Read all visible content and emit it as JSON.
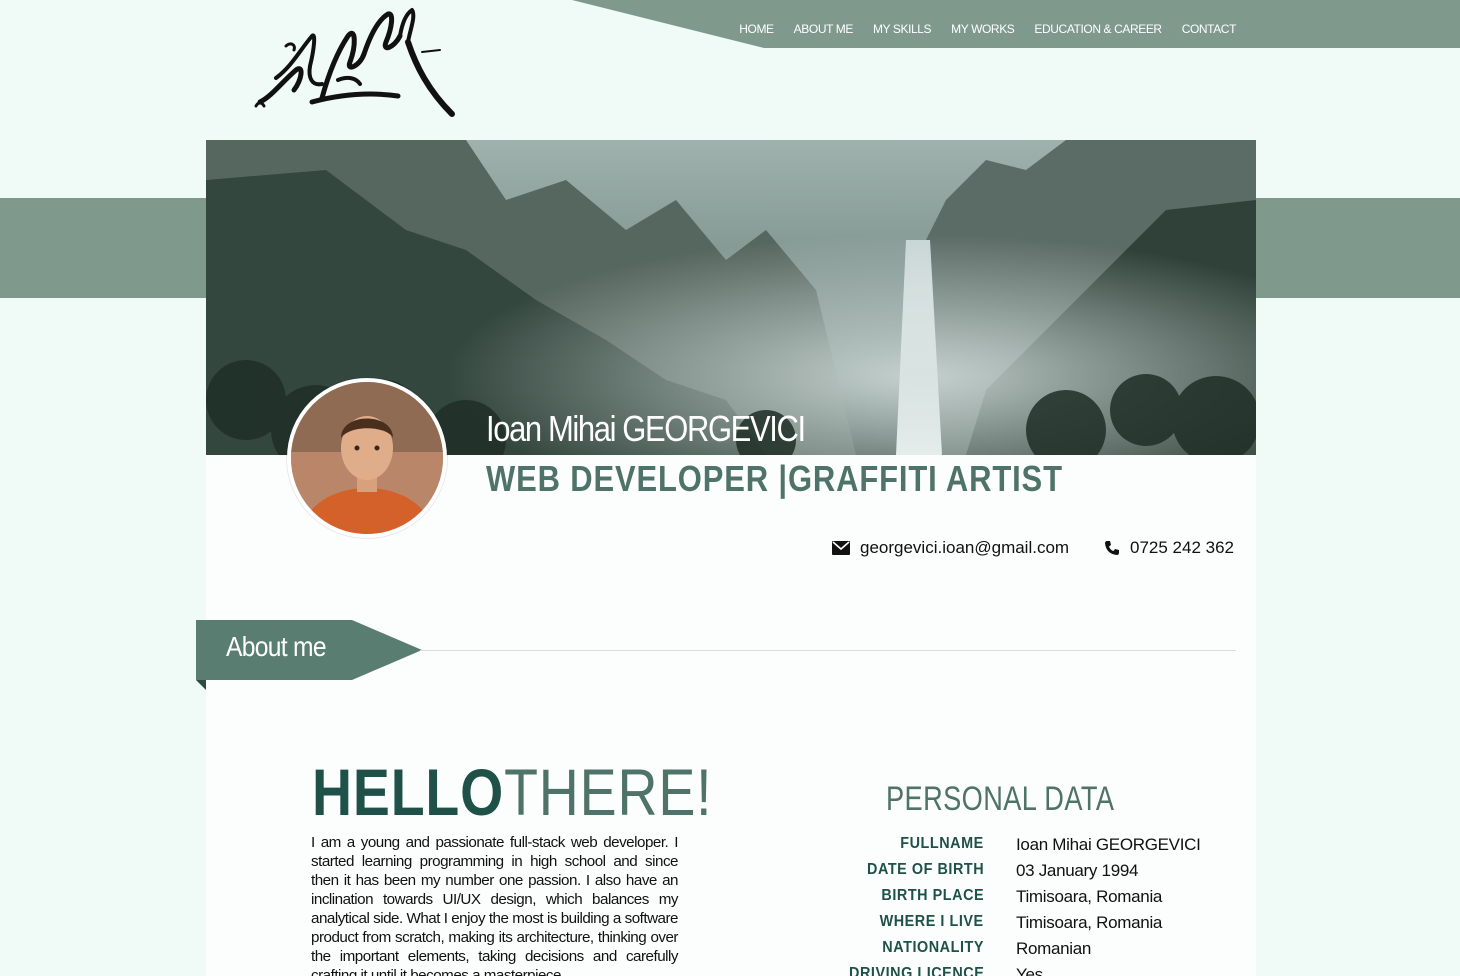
{
  "colors": {
    "accent": "#7f9a8c",
    "dark": "#1f5148",
    "mid": "#4f7368",
    "background": "#f0faf7"
  },
  "nav": {
    "items": [
      "HOME",
      "ABOUT ME",
      "MY SKILLS",
      "MY WORKS",
      "EDUCATION & CAREER",
      "CONTACT"
    ]
  },
  "logo": {
    "text": "ArGyOR"
  },
  "profile": {
    "name": "Ioan Mihai GEORGEVICI",
    "role": "WEB DEVELOPER  |GRAFFITI ARTIST",
    "email": "georgevici.ioan@gmail.com",
    "phone": "0725 242 362",
    "email_icon": "envelope-icon",
    "phone_icon": "phone-icon"
  },
  "about": {
    "section_title": "About me",
    "hello_bold": "HELLO",
    "hello_rest": "THERE!",
    "bio": "I am a young and passionate full-stack web developer. I started learning programming in high school and since then it has been my number one passion. I also have an inclination towards UI/UX design, which balances my analytical side. What I enjoy the most is building a software product from scratch, making its architecture, thinking over the important elements, taking decisions and carefully crafting it until it becomes a masterpiece."
  },
  "personal_data": {
    "title": "PERSONAL DATA",
    "rows": [
      {
        "label": "FULLNAME",
        "value": "Ioan Mihai GEORGEVICI"
      },
      {
        "label": "DATE OF BIRTH",
        "value": "03 January 1994"
      },
      {
        "label": "BIRTH PLACE",
        "value": "Timisoara, Romania"
      },
      {
        "label": "WHERE I LIVE",
        "value": "Timisoara, Romania"
      },
      {
        "label": "NATIONALITY",
        "value": "Romanian"
      },
      {
        "label": "DRIVING LICENCE",
        "value": "Yes"
      }
    ]
  }
}
